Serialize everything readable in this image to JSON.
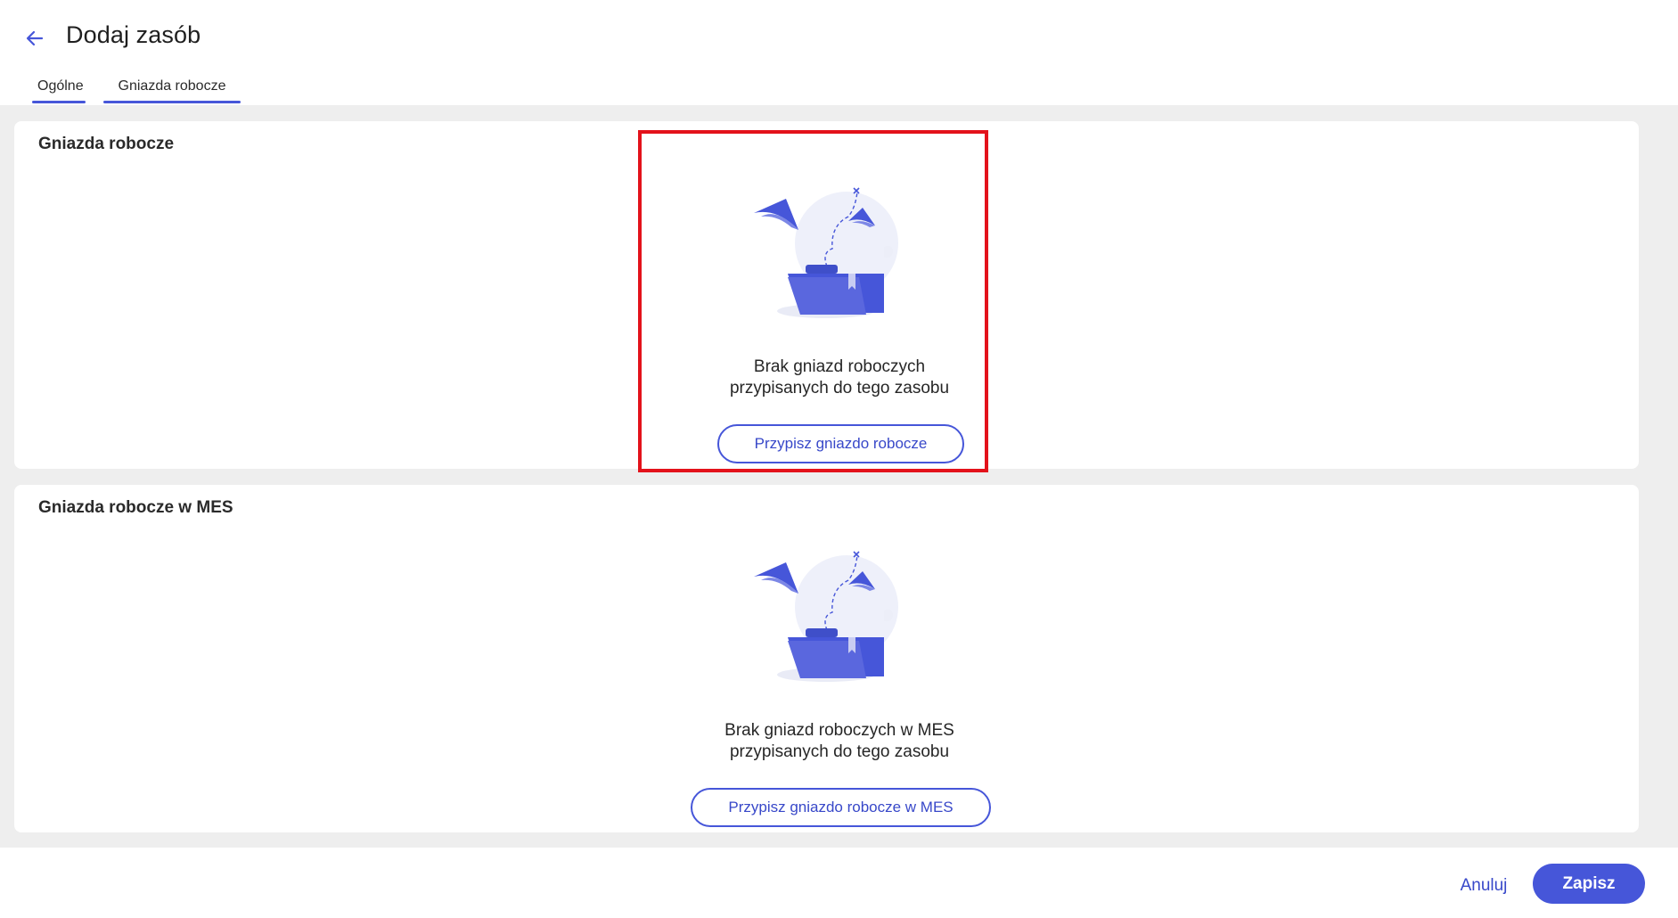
{
  "header": {
    "title": "Dodaj zasób",
    "back_icon": "arrow-left-icon",
    "tabs": [
      {
        "label": "Ogólne",
        "active": false
      },
      {
        "label": "Gniazda robocze",
        "active": true
      }
    ]
  },
  "sections": [
    {
      "title": "Gniazda robocze",
      "empty_line1": "Brak gniazd roboczych",
      "empty_line2": "przypisanych do tego zasobu",
      "button_label": "Przypisz gniazdo robocze",
      "illustration": "empty-folder-illustration"
    },
    {
      "title": "Gniazda robocze w MES",
      "empty_line1": "Brak gniazd roboczych w MES",
      "empty_line2": "przypisanych do tego zasobu",
      "button_label": "Przypisz gniazdo robocze w MES",
      "illustration": "empty-folder-illustration"
    }
  ],
  "footer": {
    "cancel_label": "Anuluj",
    "save_label": "Zapisz"
  },
  "colors": {
    "accent": "#4656d9",
    "highlight": "#e3121b",
    "background": "#eeeeee"
  }
}
